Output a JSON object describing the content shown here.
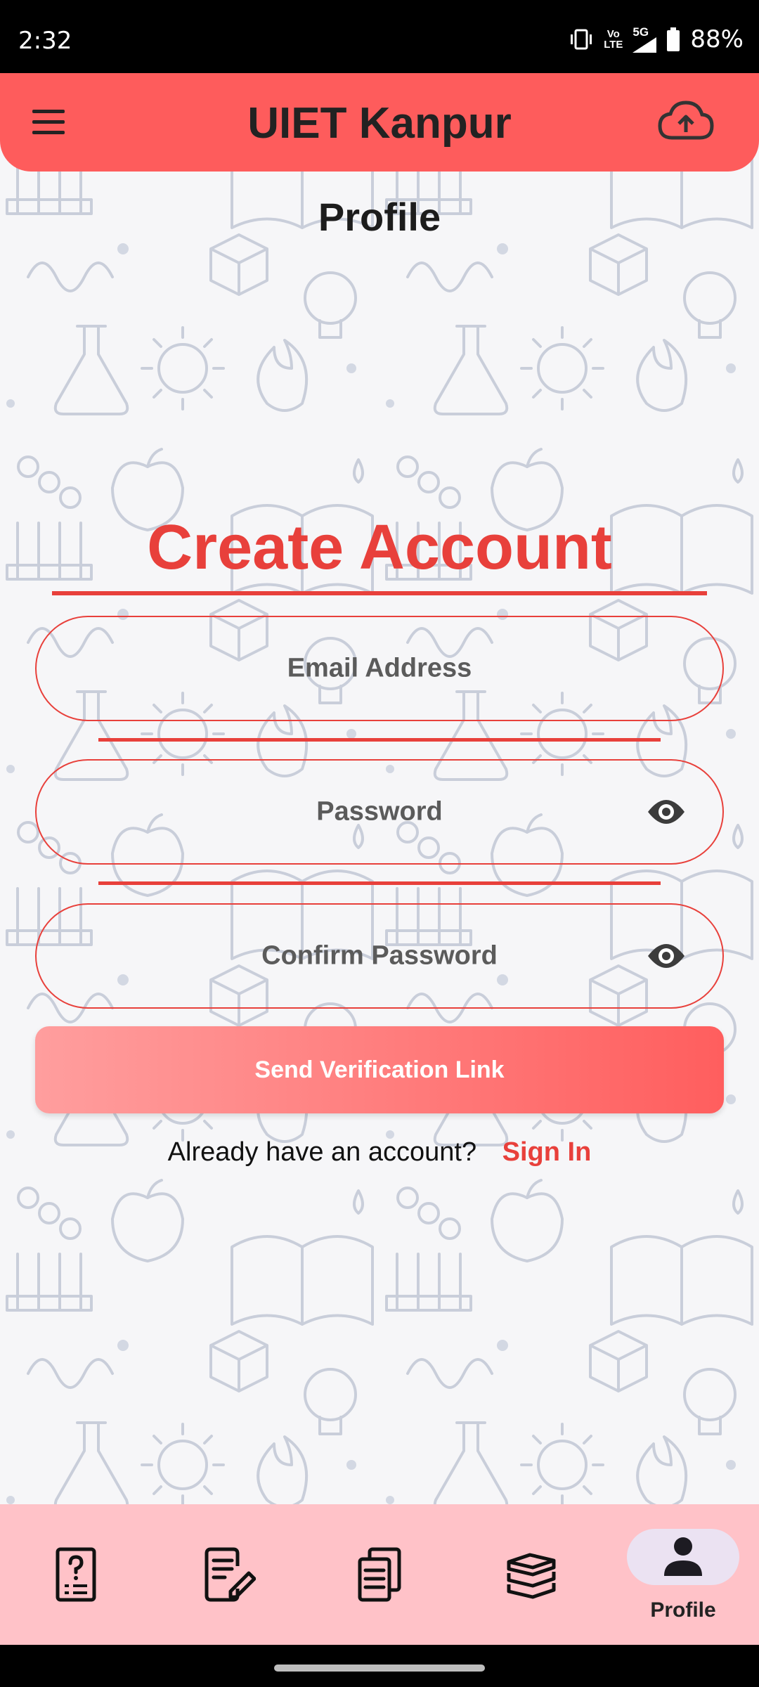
{
  "status_bar": {
    "time": "2:32",
    "network_top": "Vo",
    "network_bottom": "LTE",
    "signal": "5G",
    "battery": "88%"
  },
  "app_bar": {
    "title": "UIET Kanpur",
    "menu_icon": "menu-icon",
    "action_icon": "cloud-upload-icon"
  },
  "page": {
    "title": "Profile"
  },
  "form": {
    "heading": "Create Account",
    "email_placeholder": "Email Address",
    "password_placeholder": "Password",
    "confirm_password_placeholder": "Confirm Password",
    "submit_label": "Send Verification Link",
    "signin_prompt": "Already have an account?",
    "signin_link": "Sign In"
  },
  "bottom_nav": {
    "items": [
      {
        "icon": "question-document-icon",
        "active": false
      },
      {
        "icon": "edit-document-icon",
        "active": false
      },
      {
        "icon": "documents-icon",
        "active": false
      },
      {
        "icon": "books-icon",
        "active": false
      },
      {
        "icon": "person-icon",
        "label": "Profile",
        "active": true
      }
    ]
  },
  "colors": {
    "primary": "#fe5c5c",
    "accent_red": "#e8403b",
    "nav_bg": "#ffc2c8",
    "nav_active_pill": "#ebe2f2"
  }
}
